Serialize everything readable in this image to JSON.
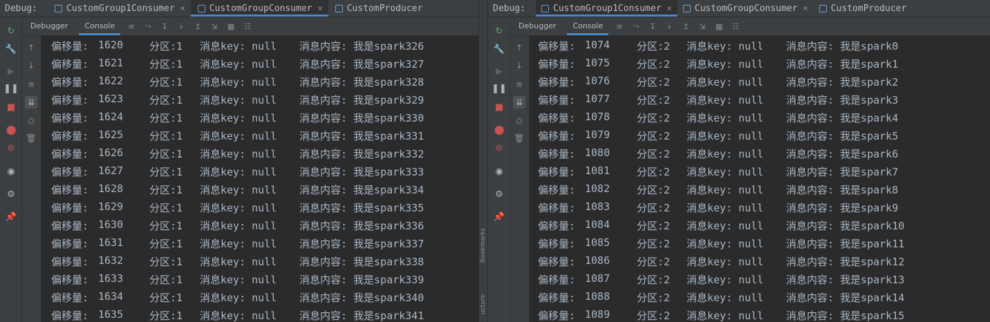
{
  "left": {
    "debug_label": "Debug:",
    "tabs": [
      "CustomGroup1Consumer",
      "CustomGroupConsumer",
      "CustomProducer"
    ],
    "active_tab": 1,
    "subtabs": [
      "Debugger",
      "Console"
    ],
    "active_subtab": 1,
    "rows": [
      {
        "offset_label": "偏移量:",
        "offset": "1620",
        "partition": "分区:1",
        "key": "消息key: null",
        "content": "消息内容: 我是spark326"
      },
      {
        "offset_label": "偏移量:",
        "offset": "1621",
        "partition": "分区:1",
        "key": "消息key: null",
        "content": "消息内容: 我是spark327"
      },
      {
        "offset_label": "偏移量:",
        "offset": "1622",
        "partition": "分区:1",
        "key": "消息key: null",
        "content": "消息内容: 我是spark328"
      },
      {
        "offset_label": "偏移量:",
        "offset": "1623",
        "partition": "分区:1",
        "key": "消息key: null",
        "content": "消息内容: 我是spark329"
      },
      {
        "offset_label": "偏移量:",
        "offset": "1624",
        "partition": "分区:1",
        "key": "消息key: null",
        "content": "消息内容: 我是spark330"
      },
      {
        "offset_label": "偏移量:",
        "offset": "1625",
        "partition": "分区:1",
        "key": "消息key: null",
        "content": "消息内容: 我是spark331"
      },
      {
        "offset_label": "偏移量:",
        "offset": "1626",
        "partition": "分区:1",
        "key": "消息key: null",
        "content": "消息内容: 我是spark332"
      },
      {
        "offset_label": "偏移量:",
        "offset": "1627",
        "partition": "分区:1",
        "key": "消息key: null",
        "content": "消息内容: 我是spark333"
      },
      {
        "offset_label": "偏移量:",
        "offset": "1628",
        "partition": "分区:1",
        "key": "消息key: null",
        "content": "消息内容: 我是spark334"
      },
      {
        "offset_label": "偏移量:",
        "offset": "1629",
        "partition": "分区:1",
        "key": "消息key: null",
        "content": "消息内容: 我是spark335"
      },
      {
        "offset_label": "偏移量:",
        "offset": "1630",
        "partition": "分区:1",
        "key": "消息key: null",
        "content": "消息内容: 我是spark336"
      },
      {
        "offset_label": "偏移量:",
        "offset": "1631",
        "partition": "分区:1",
        "key": "消息key: null",
        "content": "消息内容: 我是spark337"
      },
      {
        "offset_label": "偏移量:",
        "offset": "1632",
        "partition": "分区:1",
        "key": "消息key: null",
        "content": "消息内容: 我是spark338"
      },
      {
        "offset_label": "偏移量:",
        "offset": "1633",
        "partition": "分区:1",
        "key": "消息key: null",
        "content": "消息内容: 我是spark339"
      },
      {
        "offset_label": "偏移量:",
        "offset": "1634",
        "partition": "分区:1",
        "key": "消息key: null",
        "content": "消息内容: 我是spark340"
      },
      {
        "offset_label": "偏移量:",
        "offset": "1635",
        "partition": "分区:1",
        "key": "消息key: null",
        "content": "消息内容: 我是spark341"
      }
    ]
  },
  "divider": {
    "labels": [
      "Bookmarks",
      "ucture"
    ]
  },
  "right": {
    "debug_label": "Debug:",
    "tabs": [
      "CustomGroup1Consumer",
      "CustomGroupConsumer",
      "CustomProducer"
    ],
    "active_tab": 0,
    "subtabs": [
      "Debugger",
      "Console"
    ],
    "active_subtab": 1,
    "rows": [
      {
        "offset_label": "偏移量:",
        "offset": "1074",
        "partition": "分区:2",
        "key": "消息key: null",
        "content": "消息内容: 我是spark0"
      },
      {
        "offset_label": "偏移量:",
        "offset": "1075",
        "partition": "分区:2",
        "key": "消息key: null",
        "content": "消息内容: 我是spark1"
      },
      {
        "offset_label": "偏移量:",
        "offset": "1076",
        "partition": "分区:2",
        "key": "消息key: null",
        "content": "消息内容: 我是spark2"
      },
      {
        "offset_label": "偏移量:",
        "offset": "1077",
        "partition": "分区:2",
        "key": "消息key: null",
        "content": "消息内容: 我是spark3"
      },
      {
        "offset_label": "偏移量:",
        "offset": "1078",
        "partition": "分区:2",
        "key": "消息key: null",
        "content": "消息内容: 我是spark4"
      },
      {
        "offset_label": "偏移量:",
        "offset": "1079",
        "partition": "分区:2",
        "key": "消息key: null",
        "content": "消息内容: 我是spark5"
      },
      {
        "offset_label": "偏移量:",
        "offset": "1080",
        "partition": "分区:2",
        "key": "消息key: null",
        "content": "消息内容: 我是spark6"
      },
      {
        "offset_label": "偏移量:",
        "offset": "1081",
        "partition": "分区:2",
        "key": "消息key: null",
        "content": "消息内容: 我是spark7"
      },
      {
        "offset_label": "偏移量:",
        "offset": "1082",
        "partition": "分区:2",
        "key": "消息key: null",
        "content": "消息内容: 我是spark8"
      },
      {
        "offset_label": "偏移量:",
        "offset": "1083",
        "partition": "分区:2",
        "key": "消息key: null",
        "content": "消息内容: 我是spark9"
      },
      {
        "offset_label": "偏移量:",
        "offset": "1084",
        "partition": "分区:2",
        "key": "消息key: null",
        "content": "消息内容: 我是spark10"
      },
      {
        "offset_label": "偏移量:",
        "offset": "1085",
        "partition": "分区:2",
        "key": "消息key: null",
        "content": "消息内容: 我是spark11"
      },
      {
        "offset_label": "偏移量:",
        "offset": "1086",
        "partition": "分区:2",
        "key": "消息key: null",
        "content": "消息内容: 我是spark12"
      },
      {
        "offset_label": "偏移量:",
        "offset": "1087",
        "partition": "分区:2",
        "key": "消息key: null",
        "content": "消息内容: 我是spark13"
      },
      {
        "offset_label": "偏移量:",
        "offset": "1088",
        "partition": "分区:2",
        "key": "消息key: null",
        "content": "消息内容: 我是spark14"
      },
      {
        "offset_label": "偏移量:",
        "offset": "1089",
        "partition": "分区:2",
        "key": "消息key: null",
        "content": "消息内容: 我是spark15"
      }
    ]
  },
  "icons": {
    "side": [
      "rerun-icon",
      "settings-wrench-icon",
      "resume-icon",
      "pause-icon",
      "stop-icon",
      "view-breakpoints-icon",
      "mute-breakpoints-icon",
      "camera-icon",
      "gear-icon",
      "pin-icon"
    ],
    "inner": [
      "scroll-up-icon",
      "scroll-down-icon",
      "soft-wrap-icon",
      "scroll-to-end-icon",
      "print-icon",
      "trash-icon"
    ],
    "toolbar": [
      "menu-icon",
      "restore-layout-icon",
      "step-over-icon",
      "step-into-icon",
      "step-out-icon",
      "run-to-cursor-icon",
      "evaluate-icon",
      "settings-list-icon"
    ]
  },
  "colors": {
    "accent": "#4a88c7",
    "rerun": "#59a869",
    "stop": "#c75450",
    "breakpoint": "#c75450"
  }
}
